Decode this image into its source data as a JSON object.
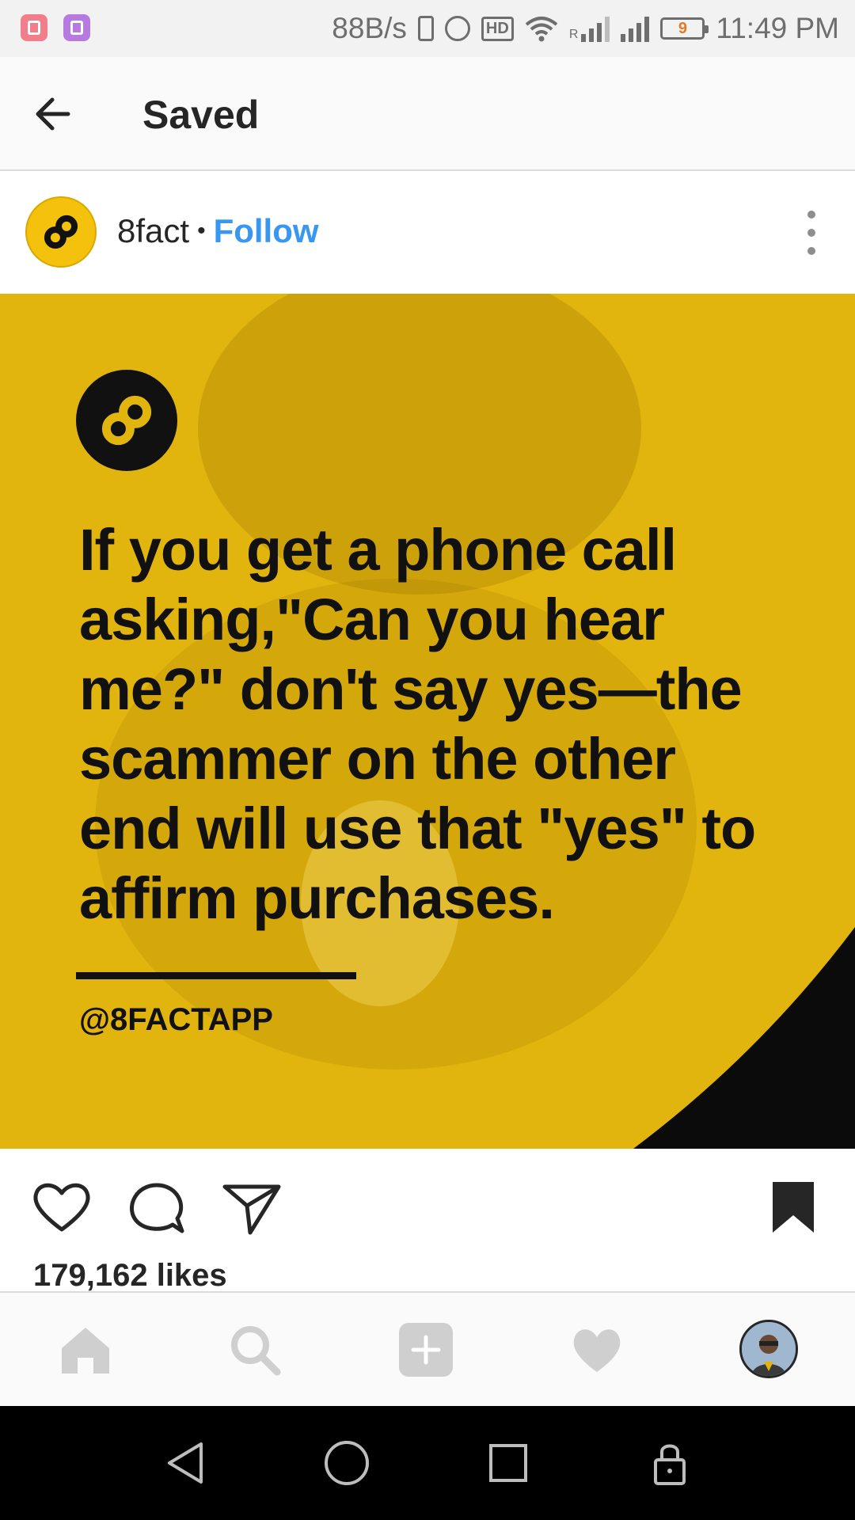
{
  "status_bar": {
    "net_speed": "88B/s",
    "hd": "HD",
    "signal_label": "R",
    "battery_level": "9",
    "time": "11:49 PM"
  },
  "header": {
    "title": "Saved"
  },
  "post": {
    "author": "8fact",
    "separator": "•",
    "follow_label": "Follow",
    "caption": "If you get a phone call asking,\"Can you hear me?\" don't say yes—the scammer on the other end will use that \"yes\" to affirm purchases.",
    "handle": "@8FACTAPP",
    "likes": "179,162 likes"
  },
  "colors": {
    "brand_yellow": "#e2b50e",
    "follow_blue": "#3897f0",
    "text": "#262626"
  },
  "icons": {
    "back": "arrow-left-icon",
    "more": "more-vertical-icon",
    "like": "heart-outline-icon",
    "comment": "comment-bubble-icon",
    "share": "paper-plane-icon",
    "save": "bookmark-filled-icon",
    "home": "home-icon",
    "search": "search-icon",
    "add": "add-post-icon",
    "activity": "heart-filled-icon",
    "profile": "profile-avatar"
  }
}
